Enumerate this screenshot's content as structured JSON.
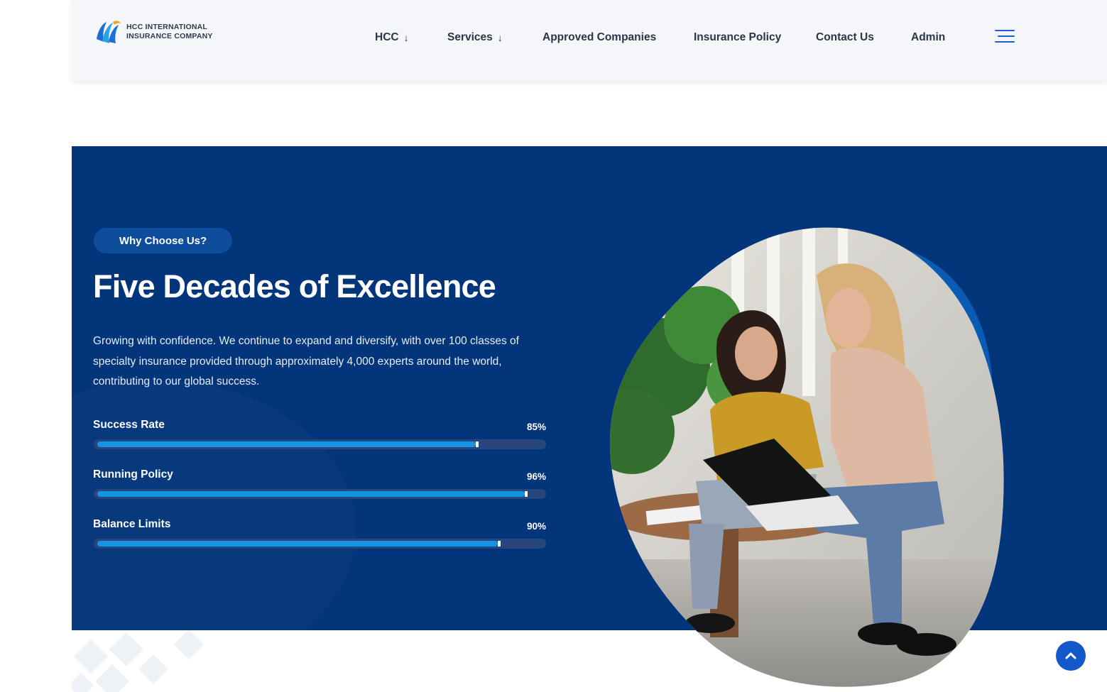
{
  "brand": {
    "line1": "HCC INTERNATIONAL",
    "line2": "INSURANCE COMPANY",
    "icon": "hcc-logo-icon"
  },
  "nav": {
    "items": [
      {
        "label": "HCC",
        "dropdown": true
      },
      {
        "label": "Services",
        "dropdown": true
      },
      {
        "label": "Approved Companies",
        "dropdown": false
      },
      {
        "label": "Insurance Policy",
        "dropdown": false
      },
      {
        "label": "Contact Us",
        "dropdown": false
      },
      {
        "label": "Admin",
        "dropdown": false
      }
    ],
    "dropdown_arrow": "↓",
    "menu_icon": "hamburger-menu-icon"
  },
  "hero": {
    "badge": "Why Choose Us?",
    "title": "Five Decades of Excellence",
    "description": "Growing with confidence. We continue to expand and diversify, with over 100 classes of specialty insurance provided through approximately 4,000 experts around the world, contributing to our global success.",
    "stats": [
      {
        "label": "Success Rate",
        "value": 85,
        "display": "85%"
      },
      {
        "label": "Running Policy",
        "value": 96,
        "display": "96%"
      },
      {
        "label": "Balance Limits",
        "value": 90,
        "display": "90%"
      }
    ]
  },
  "colors": {
    "section_bg": "#03357a",
    "accent": "#1693e4",
    "header_bg": "#f4f6fa",
    "badge_bg": "#0d4d9c",
    "scroll_button": "#1358c8"
  },
  "scroll_top": {
    "icon": "chevron-up-icon"
  }
}
